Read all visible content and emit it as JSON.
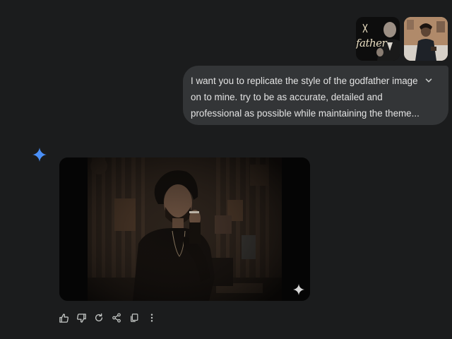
{
  "attachments": {
    "first_image": {
      "word": "father"
    }
  },
  "prompt": {
    "lines": [
      "I want you to replicate the style of the godfather image",
      "on to mine. try to be as accurate, detailed and",
      "professional as possible while maintaining the theme..."
    ]
  },
  "icons": {
    "expand": "chevron-down-icon",
    "assistant": "sparkle-icon",
    "image_badge": "sparkle-icon",
    "actions": [
      "thumbs-up-icon",
      "thumbs-down-icon",
      "regenerate-icon",
      "share-icon",
      "copy-icon",
      "more-vert-icon"
    ]
  },
  "colors": {
    "background": "#1b1c1d",
    "bubble": "#333537",
    "text": "#e3e3e3",
    "accent": "#4a8ff7",
    "icon": "#c4c7c5"
  }
}
